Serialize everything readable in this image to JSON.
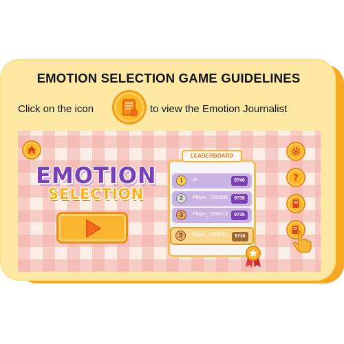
{
  "guide": {
    "title": "EMOTION SELECTION GAME GUIDELINES",
    "instruction_before": "Click on the icon",
    "instruction_after": "to view the Emotion Journalist",
    "icon": "journal-icon"
  },
  "game": {
    "logo_line1": "EMOTION",
    "logo_line2": "SELECTION",
    "buttons": [
      "home-icon",
      "settings-icon",
      "help-icon",
      "journal-icon",
      "journal-edit-icon"
    ],
    "play_icon": "play-icon",
    "leaderboard": {
      "title": "LEADERBOARD",
      "rows": [
        {
          "rank": "1",
          "name": "ok",
          "score": "9746"
        },
        {
          "rank": "2",
          "name": "Player_7256906",
          "score": "9738"
        },
        {
          "rank": "3",
          "name": "Player_7256416",
          "score": "9736"
        }
      ],
      "current": {
        "rank": "3",
        "name": "Player_7256416",
        "score": "9736"
      }
    }
  },
  "colors": {
    "accent_orange": "#fcb422",
    "card_bg": "#fde9a3",
    "logo_purple": "#7b3fb8",
    "score_purple": "#7a3fb2"
  }
}
